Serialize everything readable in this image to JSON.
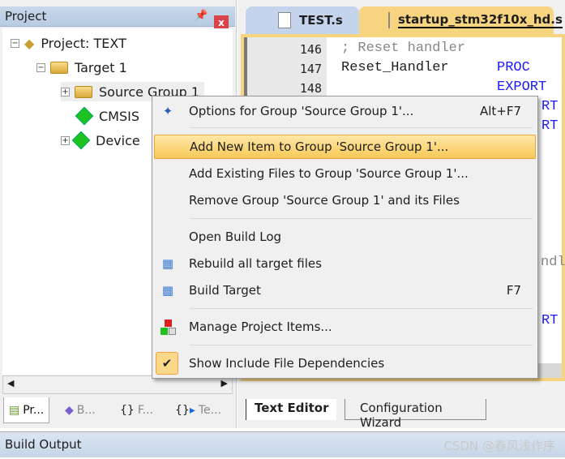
{
  "project_panel": {
    "title": "Project",
    "pin_icon": "pin-icon",
    "close_label": "x",
    "tree": [
      {
        "label": "Project: TEXT",
        "expander": "−"
      },
      {
        "label": "Target 1",
        "expander": "−"
      },
      {
        "label": "Source Group 1",
        "expander": "+"
      },
      {
        "label": "CMSIS",
        "expander": ""
      },
      {
        "label": "Device",
        "expander": "+"
      }
    ],
    "tabs": [
      {
        "label": "Pr..."
      },
      {
        "label": "B..."
      },
      {
        "label": "F..."
      },
      {
        "label": "Te..."
      }
    ]
  },
  "editor": {
    "tabs": [
      {
        "label": "TEST.s",
        "active": false
      },
      {
        "label": "startup_stm32f10x_hd.s",
        "active": true
      }
    ],
    "lines": [
      {
        "num": "146",
        "text": "; Reset handler"
      },
      {
        "num": "147",
        "text": "Reset_Handler",
        "kw": "PROC"
      },
      {
        "num": "148",
        "text": "",
        "kw": "EXPORT"
      }
    ],
    "fragments": [
      "RT",
      "RT",
      "ndl",
      "RT"
    ],
    "bottom_tabs": [
      {
        "label": "Text Editor",
        "active": true
      },
      {
        "label": "Configuration Wizard",
        "active": false
      }
    ]
  },
  "context_menu": {
    "items": [
      {
        "label": "Options for Group 'Source Group 1'...",
        "shortcut": "Alt+F7",
        "icon": "magic-wand-icon"
      },
      {
        "label": "Add New  Item to Group 'Source Group 1'...",
        "highlighted": true
      },
      {
        "label": "Add Existing Files to Group 'Source Group 1'..."
      },
      {
        "label": "Remove Group 'Source Group 1' and its Files"
      },
      {
        "label": "Open Build Log"
      },
      {
        "label": "Rebuild all target files",
        "icon": "rebuild-icon"
      },
      {
        "label": "Build Target",
        "shortcut": "F7",
        "icon": "build-icon"
      },
      {
        "label": "Manage Project Items...",
        "icon": "manage-items-icon"
      },
      {
        "label": "Show Include File Dependencies",
        "icon": "checkmark-icon",
        "checked": true
      }
    ]
  },
  "build_output": {
    "title": "Build Output"
  },
  "watermark": "CSDN @春风浅作序",
  "colors": {
    "accent": "#f9c958",
    "keyword": "#1a1aff",
    "panel_title": "#c9d8ea"
  }
}
